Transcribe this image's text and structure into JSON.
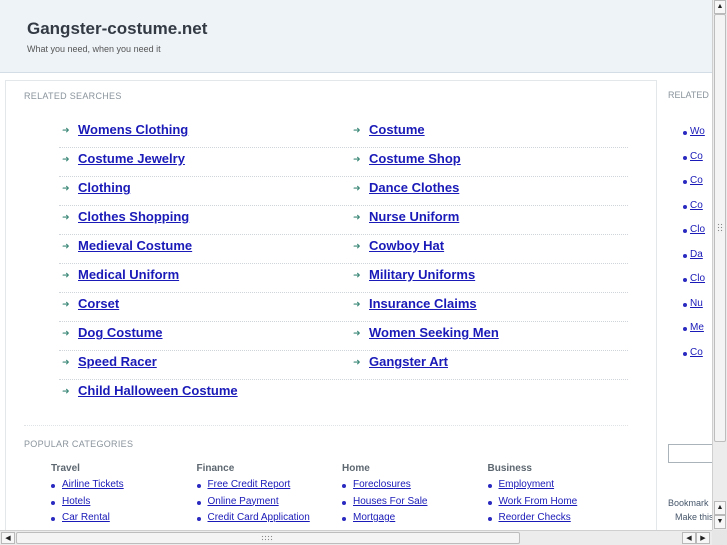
{
  "site": {
    "title": "Gangster-costume.net",
    "tagline": "What you need, when you need it"
  },
  "related": {
    "title": "RELATED SEARCHES",
    "left": [
      "Womens Clothing",
      "Costume Jewelry",
      "Clothing",
      "Clothes Shopping",
      "Medieval Costume",
      "Medical Uniform",
      "Corset",
      "Dog Costume",
      "Speed Racer",
      "Child Halloween Costume"
    ],
    "right": [
      "Costume",
      "Costume Shop",
      "Dance Clothes",
      "Nurse Uniform",
      "Cowboy Hat",
      "Military Uniforms",
      "Insurance Claims",
      "Women Seeking Men",
      "Gangster Art"
    ]
  },
  "popular": {
    "title": "POPULAR CATEGORIES",
    "columns": [
      {
        "head": "Travel",
        "items": [
          "Airline Tickets",
          "Hotels",
          "Car Rental"
        ]
      },
      {
        "head": "Finance",
        "items": [
          "Free Credit Report",
          "Online Payment",
          "Credit Card Application"
        ]
      },
      {
        "head": "Home",
        "items": [
          "Foreclosures",
          "Houses For Sale",
          "Mortgage"
        ]
      },
      {
        "head": "Business",
        "items": [
          "Employment",
          "Work From Home",
          "Reorder Checks"
        ]
      }
    ]
  },
  "sidebar": {
    "title": "RELATED",
    "items": [
      "Wo",
      "Co",
      "Co",
      "Co",
      "Clo",
      "Da",
      "Clo",
      "Nu",
      "Me",
      "Co"
    ],
    "bookmark": "Bookmark",
    "make": "Make this"
  },
  "icons": {
    "arrow": "triangle-right-icon",
    "bullet": "bullet-icon"
  },
  "colors": {
    "link": "#1a1ab8",
    "arrow": "#3f8a7a",
    "header_bg": "#eef3f7"
  }
}
